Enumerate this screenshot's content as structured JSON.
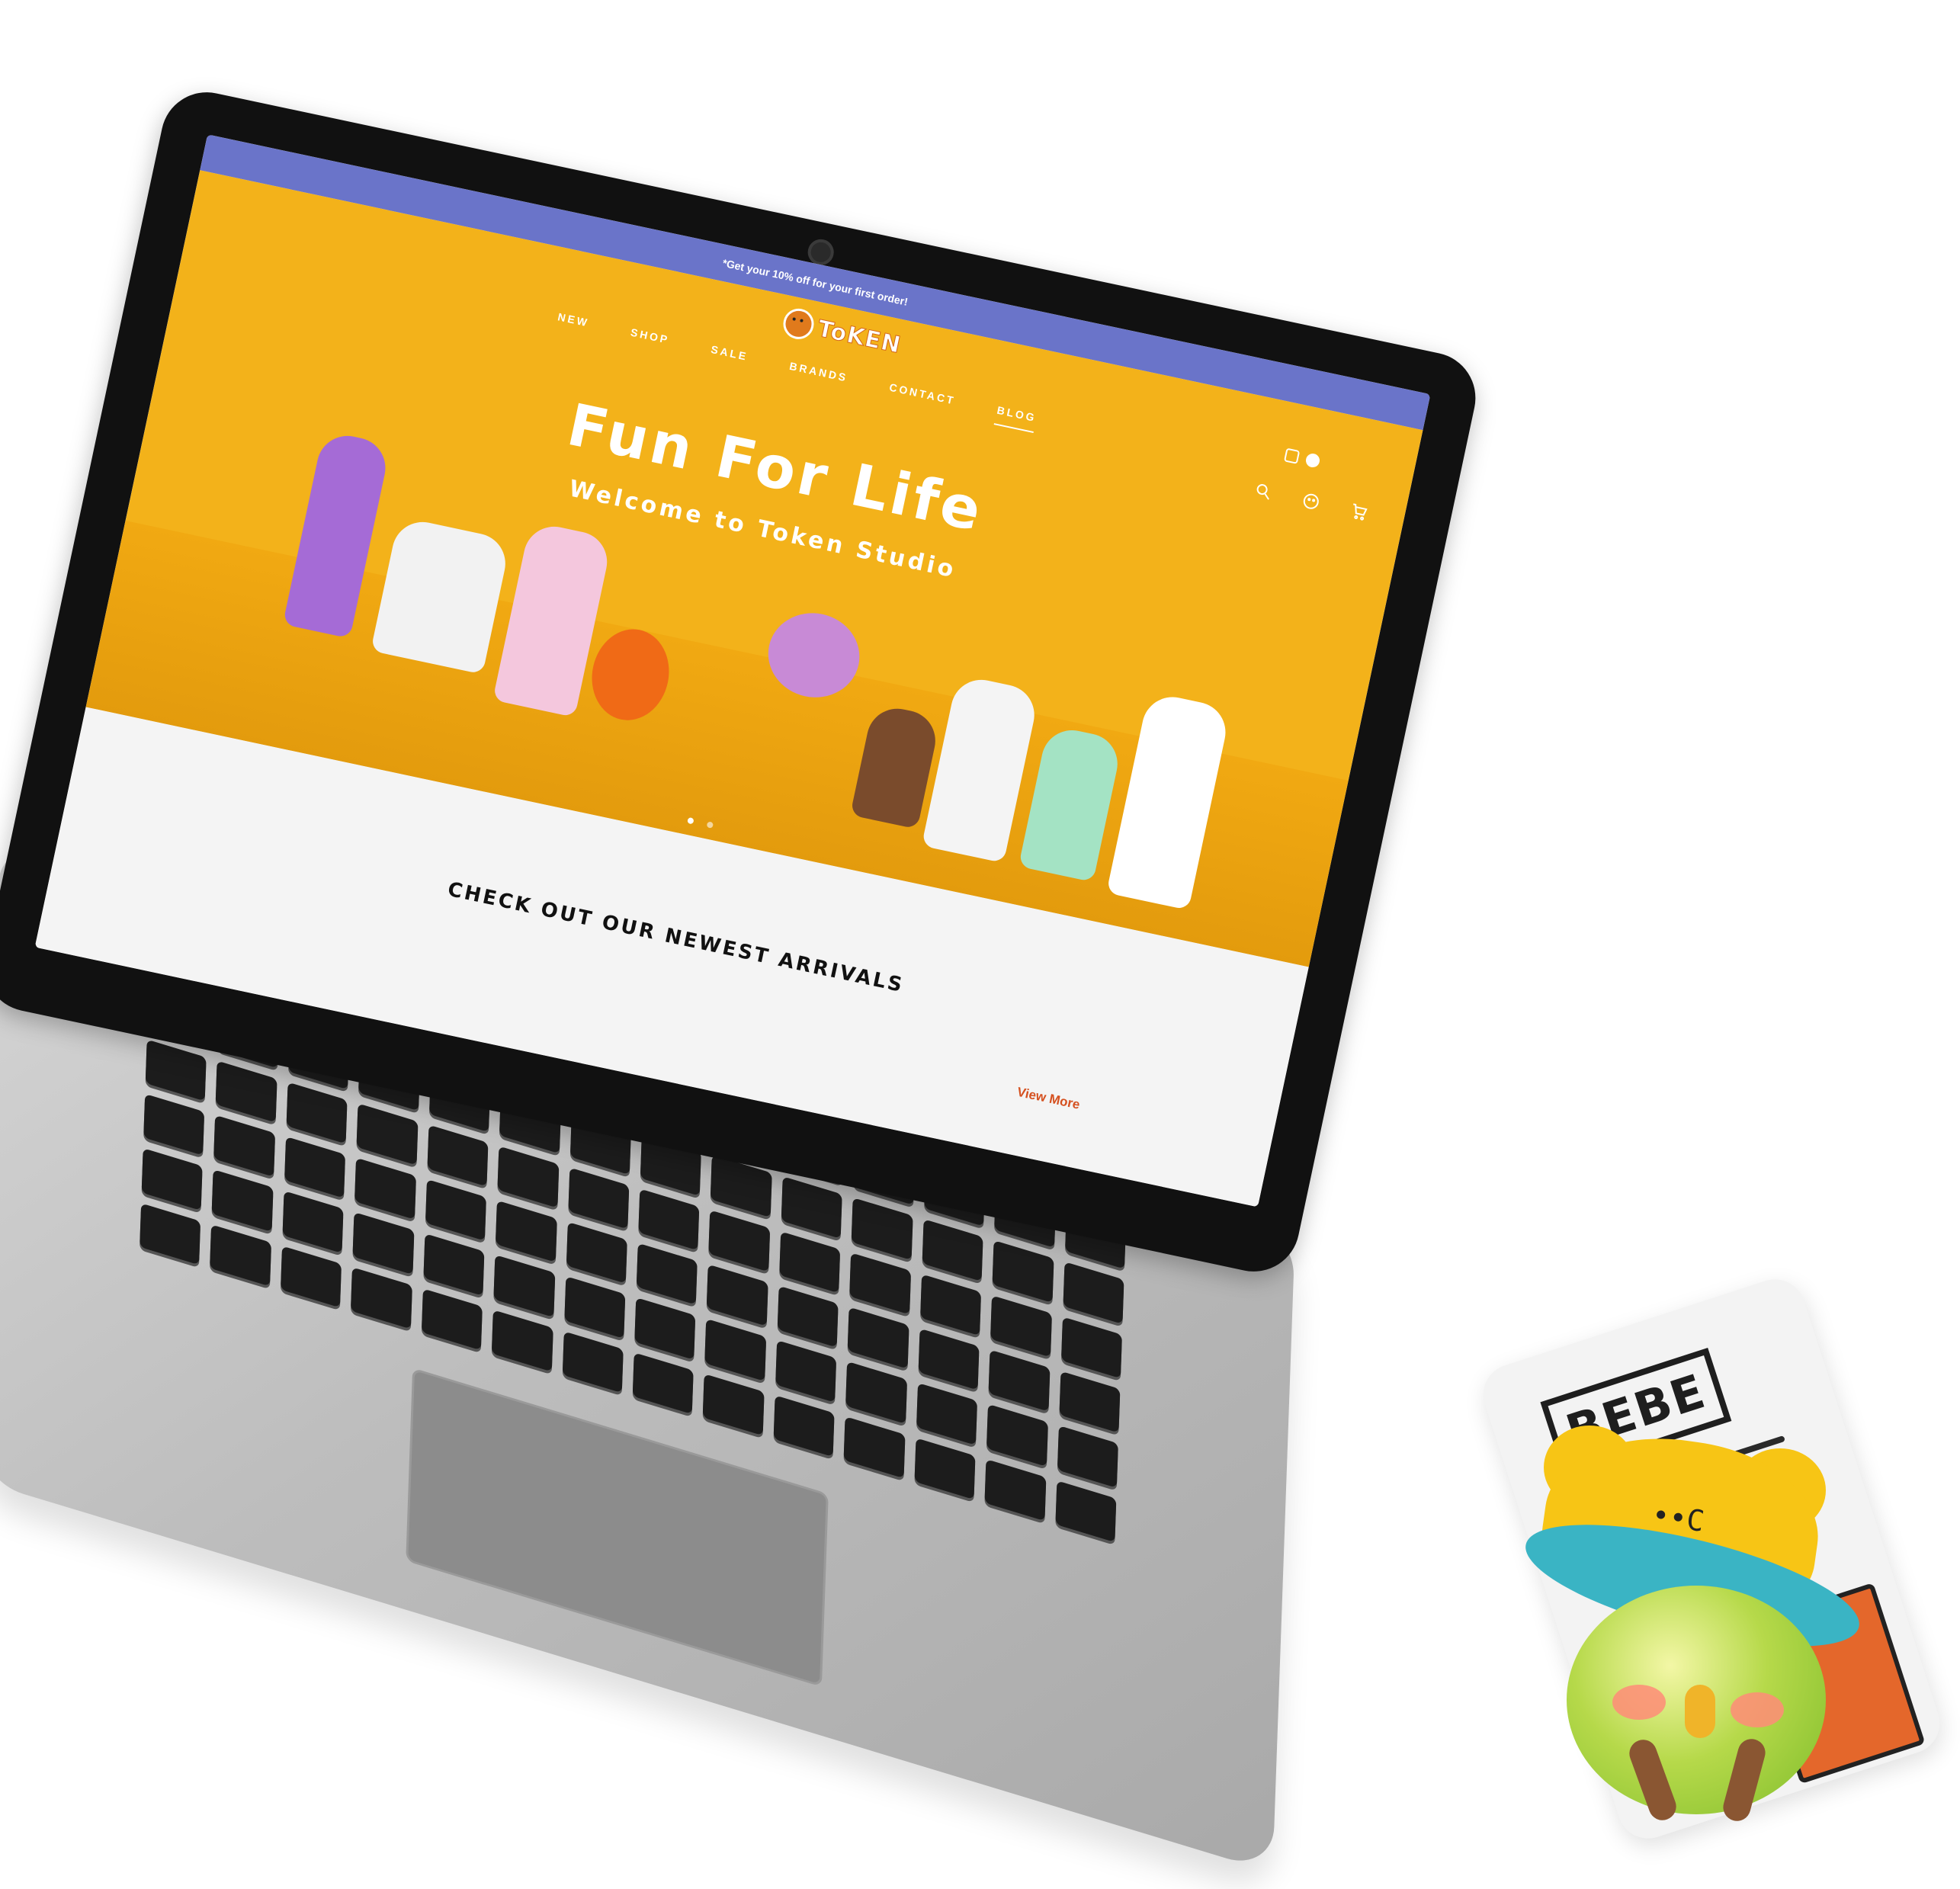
{
  "announcement": "*Get your 10% off for your first order!",
  "brand": {
    "logo_text": "ToKEN"
  },
  "nav": [
    {
      "label": "NEW"
    },
    {
      "label": "SHOP"
    },
    {
      "label": "SALE"
    },
    {
      "label": "BRANDS"
    },
    {
      "label": "CONTACT"
    },
    {
      "label": "BLOG",
      "active": true
    }
  ],
  "header_icons": [
    "search-icon",
    "account-icon",
    "cart-icon"
  ],
  "social_icons": [
    "instagram-icon",
    "facebook-icon"
  ],
  "hero": {
    "headline": "Fun For Life",
    "subheadline": "Welcome to Token Studio",
    "slide_count": 2,
    "active_slide": 1,
    "colors": {
      "background": "#f3b21a",
      "announcement_bar": "#6a74c9"
    }
  },
  "arrivals": {
    "title": "CHECK OUT OUR NEWEST ARRIVALS",
    "view_more": "View More",
    "link_color": "#d5501f"
  },
  "figure": {
    "newspaper_title": "BEBE"
  }
}
